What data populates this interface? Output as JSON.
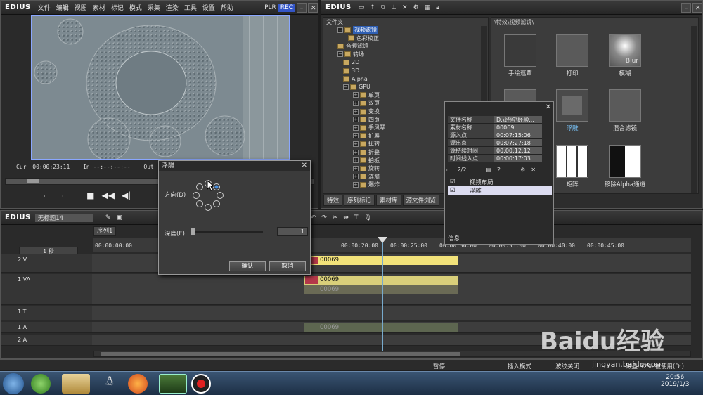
{
  "player": {
    "logo": "EDIUS",
    "menu": [
      "文件",
      "编辑",
      "视图",
      "素材",
      "标记",
      "模式",
      "采集",
      "渲染",
      "工具",
      "设置",
      "帮助"
    ],
    "plr": "PLR",
    "rec": "REC",
    "cur_label": "Cur",
    "cur_value": "00:00:23:11",
    "in_label": "In",
    "in_value": "--:--:--:--",
    "out_label": "Out",
    "out_value": "--:--:--:--"
  },
  "asset": {
    "logo": "EDIUS",
    "tree_header": "文件夹",
    "breadcrumb": "\\特效\\视频滤镜\\",
    "tree": [
      {
        "label": "视频滤镜",
        "selected": true
      },
      {
        "label": "色彩校正"
      },
      {
        "label": "音频滤镜"
      },
      {
        "label": "转场"
      },
      {
        "label": "2D"
      },
      {
        "label": "3D"
      },
      {
        "label": "Alpha"
      },
      {
        "label": "GPU"
      },
      {
        "label": "单页"
      },
      {
        "label": "双页"
      },
      {
        "label": "变换"
      },
      {
        "label": "四页"
      },
      {
        "label": "手风琴"
      },
      {
        "label": "扩展"
      },
      {
        "label": "扭转"
      },
      {
        "label": "折叠"
      },
      {
        "label": "拍板"
      },
      {
        "label": "旋转"
      },
      {
        "label": "涟漪"
      },
      {
        "label": "爆炸"
      }
    ],
    "tabs": [
      "特效",
      "序列标记",
      "素材库",
      "源文件浏览"
    ],
    "effects": [
      {
        "label": "手绘遮罩"
      },
      {
        "label": "打印"
      },
      {
        "label": "模糊",
        "thumb_text": "Blur"
      },
      {
        "label": "",
        "partial": true
      },
      {
        "label": "浮雕",
        "highlight": true
      },
      {
        "label": "混合滤镜"
      },
      {
        "label": ""
      },
      {
        "label": "矩阵"
      },
      {
        "label": "移除Alpha通道"
      }
    ]
  },
  "info": {
    "rows": [
      {
        "k": "文件名称",
        "v": "D:\\经验\\经验..."
      },
      {
        "k": "素材名称",
        "v": "00069"
      },
      {
        "k": "源入点",
        "v": "00:07:15:06"
      },
      {
        "k": "源出点",
        "v": "00:07:27:18"
      },
      {
        "k": "源持续时间",
        "v": "00:00:12:12"
      },
      {
        "k": "时间线入点",
        "v": "00:00:17:03"
      }
    ],
    "count": "2/2",
    "count2": "2",
    "list": [
      {
        "label": "视频布局"
      },
      {
        "label": "浮雕"
      }
    ],
    "footer": "信息"
  },
  "dialog": {
    "title": "浮雕",
    "direction_label": "方向(D)",
    "depth_label": "深度(E)",
    "depth_value": "1",
    "ok": "确认",
    "cancel": "取消"
  },
  "timeline": {
    "logo": "EDIUS",
    "project": "无标题14",
    "sequence_tab": "序列1",
    "zoom": "1 秒",
    "ruler": [
      "00:00:00:00",
      "00:00:20:00",
      "00:00:25:00",
      "00:00:30:00",
      "00:00:35:00",
      "00:00:40:00",
      "00:00:45:00"
    ],
    "tracks": [
      {
        "name": "2 V"
      },
      {
        "name": "1 VA"
      },
      {
        "name": "1 T"
      },
      {
        "name": "1 A"
      },
      {
        "name": "2 A"
      }
    ],
    "clip_name": "00069"
  },
  "status": {
    "pause": "暂停",
    "insert": "插入模式",
    "ripple": "波纹关闭",
    "disk": "磁盘:52% 被使用(D:)"
  },
  "taskbar": {
    "time": "20:56",
    "date": "2019/1/3"
  },
  "watermark": {
    "brand": "Baidu经验",
    "url": "jingyan.baidu.com"
  }
}
